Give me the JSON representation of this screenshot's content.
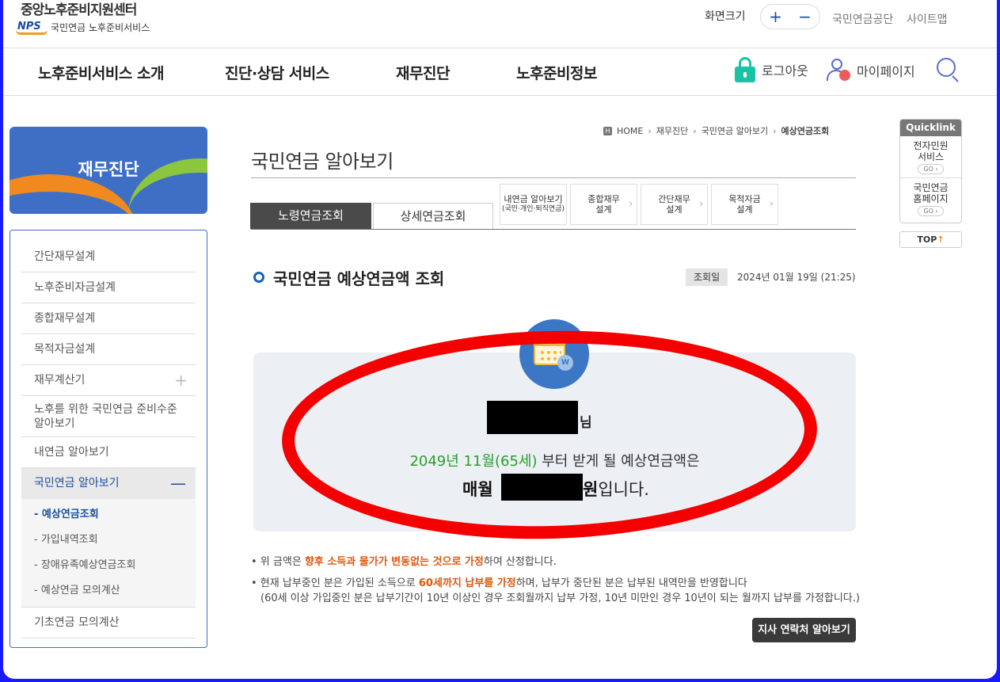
{
  "header": {
    "org_title": "중앙노후준비지원센터",
    "logo_text": "NPS",
    "logo_sub": "국민연금 노후준비서비스",
    "fontsize_label": "화면크기",
    "fontsize_plus": "+",
    "fontsize_minus": "−",
    "links": [
      "국민연금공단",
      "사이트맵"
    ]
  },
  "gnb": {
    "items": [
      "노후준비서비스 소개",
      "진단·상담 서비스",
      "재무진단",
      "노후준비정보"
    ],
    "logout": "로그아웃",
    "mypage": "마이페이지"
  },
  "sidebar": {
    "banner_title": "재무진단",
    "items": [
      "간단재무설계",
      "노후준비자금설계",
      "종합재무설계",
      "목적자금설계",
      "재무계산기",
      "노후를 위한 국민연금 준비수준 알아보기",
      "내연금 알아보기",
      "국민연금 알아보기"
    ],
    "sub_items": [
      "- 예상연금조회",
      "- 가입내역조회",
      "- 장애유족예상연금조회",
      "- 예상연금 모의계산"
    ],
    "last_item": "기초연금 모의계산"
  },
  "breadcrumb": {
    "home": "HOME",
    "items": [
      "재무진단",
      "국민연금 알아보기"
    ],
    "current": "예상연금조회"
  },
  "page_title": "국민연금 알아보기",
  "tabs": {
    "main": [
      "노령연금조회",
      "상세연금조회"
    ],
    "small": [
      {
        "label": "내연금 알아보기",
        "note": "(국민·개인·퇴직연금)"
      },
      {
        "label": "종합재무 설계"
      },
      {
        "label": "간단재무 설계"
      },
      {
        "label": "목적자금 설계"
      }
    ]
  },
  "section": {
    "title": "국민연금 예상연금액 조회",
    "inquiry_label": "조회일",
    "inquiry_date": "2024년 01월 19일 (21:25)"
  },
  "result": {
    "name_suffix": "님",
    "start_green": "2049년 11월(65세)",
    "start_rest": " 부터 받게 될 예상연금액은",
    "monthly_prefix": "매월",
    "won": "원",
    "won_suffix": "입니다.",
    "coin_symbol": "W"
  },
  "notes": {
    "n1_pre": "• 위 금액은 ",
    "n1_orange": "향후 소득과 물가가 변동없는 것으로 가정",
    "n1_post": "하여 산정합니다.",
    "n2_pre": "• 현재 납부중인 분은 가입된 소득으로 ",
    "n2_orange": "60세까지 납부를 가정",
    "n2_post": "하며, 납부가 중단된 분은 납부된 내역만을 반영합니다",
    "n3": "(60세 이상 가입중인 분은 납부기간이 10년 이상인 경우 조회월까지 납부 가정, 10년 미만인 경우 10년이 되는 월까지 납부를 가정합니다.)"
  },
  "branch_button": "지사 연락처 알아보기",
  "quicklink": {
    "title": "Quicklink",
    "items": [
      "전자민원 서비스",
      "국민연금 홈페이지"
    ],
    "go": "GO ›",
    "top": "TOP"
  },
  "colors": {
    "accent_blue": "#1a4ea1",
    "highlight_green": "#2a9d2a",
    "highlight_orange": "#e0550d",
    "annotation_red": "#f40000"
  }
}
